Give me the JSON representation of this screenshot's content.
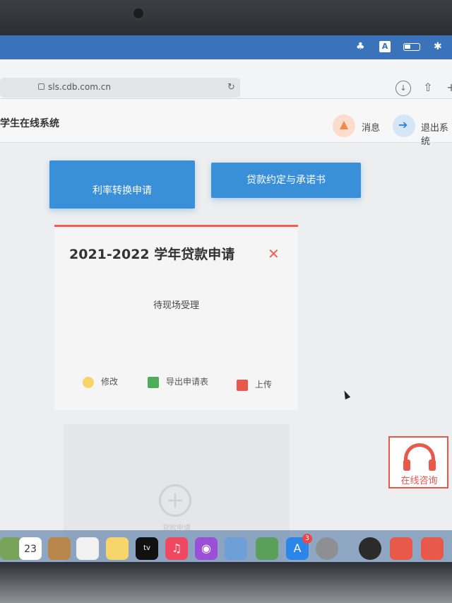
{
  "browser": {
    "url": "sls.cdb.com.cn"
  },
  "header": {
    "site_title": "学生在线系统",
    "messages_label": "消息",
    "logout_label": "退出系统"
  },
  "actions": {
    "rate_conversion": "利率转换申请",
    "loan_agreement": "贷款约定与承诺书"
  },
  "card": {
    "title": "2021-2022 学年贷款申请",
    "status": "待现场受理",
    "edit": "修改",
    "export": "导出申请表",
    "upload": "上传"
  },
  "add_card": {
    "label": "贷款申请"
  },
  "consult": {
    "label": "在线咨询"
  },
  "dock": {
    "calendar_day": "23",
    "tv_label": "tv",
    "appstore_badge": "3"
  },
  "colors": {
    "primary_blue": "#3a8fd9",
    "accent_red": "#f05d55"
  }
}
